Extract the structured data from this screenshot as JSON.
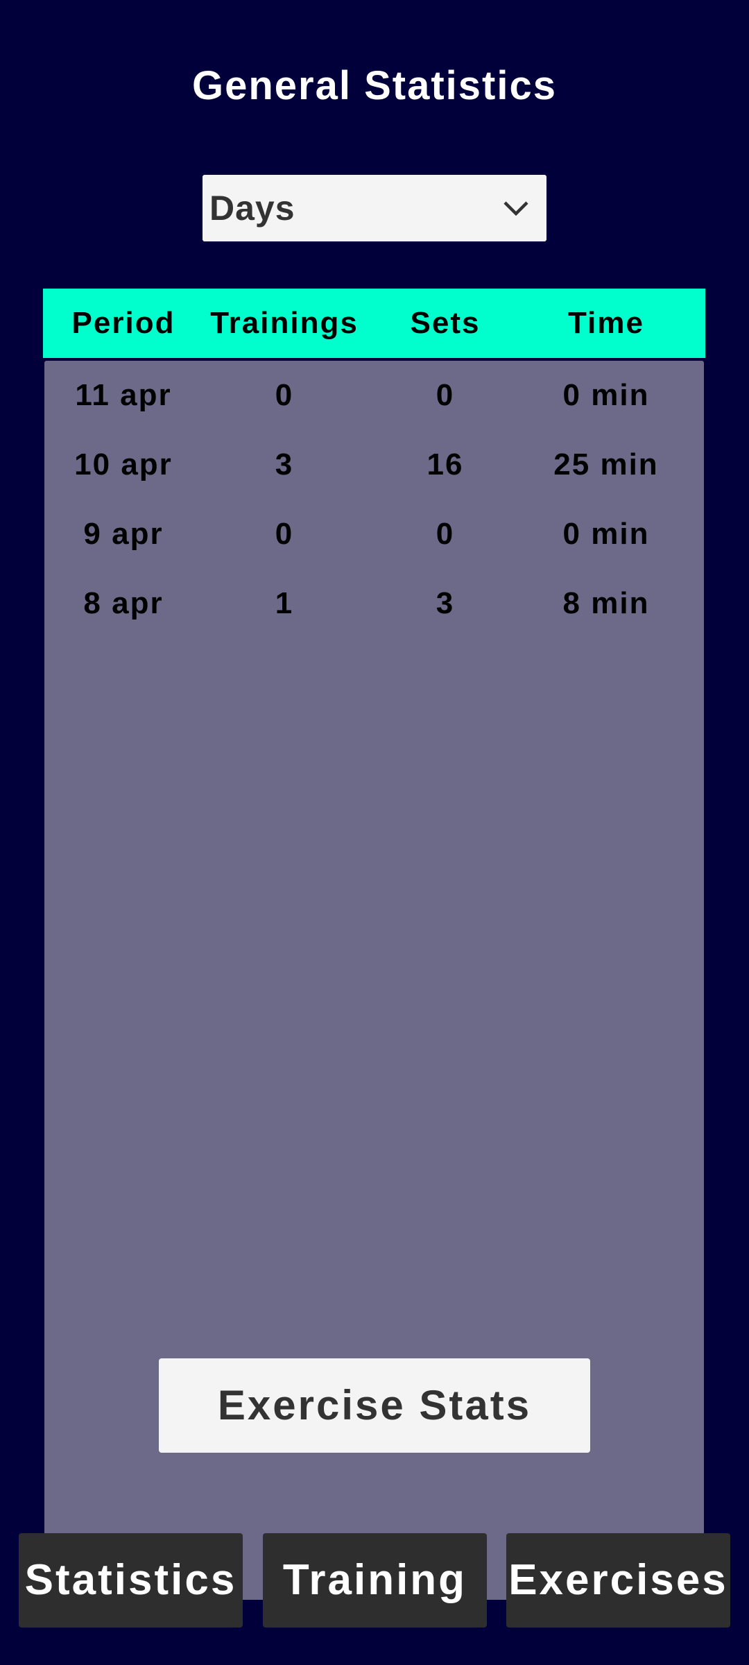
{
  "page": {
    "title": "General Statistics"
  },
  "period_select": {
    "selected": "Days",
    "icon": "chevron-down-icon"
  },
  "table": {
    "headers": [
      "Period",
      "Trainings",
      "Sets",
      "Time"
    ],
    "rows": [
      [
        "11 apr",
        "0",
        "0",
        "0 min"
      ],
      [
        "10 apr",
        "3",
        "16",
        "25 min"
      ],
      [
        "9 apr",
        "0",
        "0",
        "0 min"
      ],
      [
        "8 apr",
        "1",
        "3",
        "8 min"
      ]
    ]
  },
  "exercise_stats_button": {
    "label": "Exercise Stats"
  },
  "bottom_nav": {
    "items": [
      {
        "label": "Statistics"
      },
      {
        "label": "Training"
      },
      {
        "label": "Exercises"
      }
    ]
  },
  "colors": {
    "background": "#02003a",
    "table_header": "#00ffcc",
    "table_body": "#6c6a88",
    "light_button": "#f4f4f4",
    "dark_button": "#2e2e2e"
  }
}
